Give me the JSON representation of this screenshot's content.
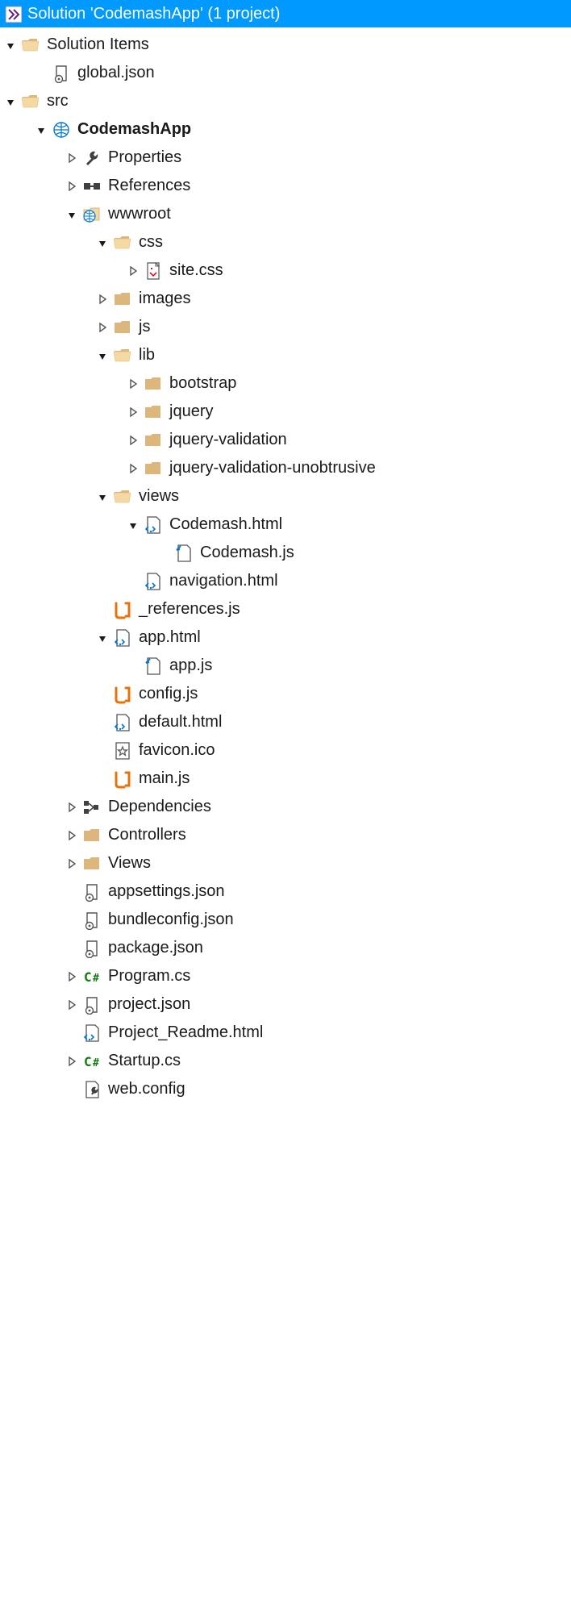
{
  "header": {
    "title": "Solution 'CodemashApp' (1 project)"
  },
  "tree": {
    "solutionItems": "Solution Items",
    "globalJson": "global.json",
    "src": "src",
    "project": "CodemashApp",
    "properties": "Properties",
    "references": "References",
    "wwwroot": "wwwroot",
    "css": "css",
    "siteCss": "site.css",
    "images": "images",
    "js": "js",
    "lib": "lib",
    "bootstrap": "bootstrap",
    "jquery": "jquery",
    "jqueryValidation": "jquery-validation",
    "jqueryValidationUnobtrusive": "jquery-validation-unobtrusive",
    "views": "views",
    "codemashHtml": "Codemash.html",
    "codemashJs": "Codemash.js",
    "navigationHtml": "navigation.html",
    "referencesJs": "_references.js",
    "appHtml": "app.html",
    "appJs": "app.js",
    "configJs": "config.js",
    "defaultHtml": "default.html",
    "faviconIco": "favicon.ico",
    "mainJs": "main.js",
    "dependencies": "Dependencies",
    "controllers": "Controllers",
    "viewsFolder": "Views",
    "appsettings": "appsettings.json",
    "bundleconfig": "bundleconfig.json",
    "package": "package.json",
    "programCs": "Program.cs",
    "projectJson": "project.json",
    "projectReadme": "Project_Readme.html",
    "startupCs": "Startup.cs",
    "webConfig": "web.config"
  }
}
